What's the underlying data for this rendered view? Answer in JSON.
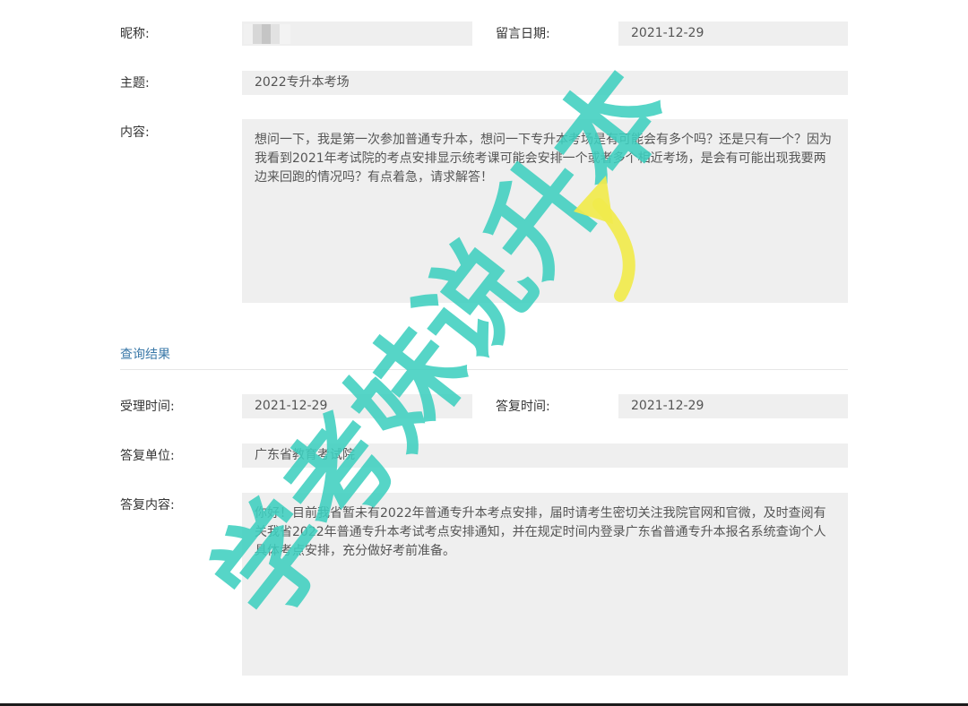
{
  "form": {
    "nickname_label": "昵称:",
    "nickname_value": "",
    "date_label": "留言日期:",
    "date_value": "2021-12-29",
    "subject_label": "主题:",
    "subject_value": "2022专升本考场",
    "content_label": "内容:",
    "content_value": "想问一下，我是第一次参加普通专升本，想问一下专升本考场是有可能会有多个吗？还是只有一个？因为我看到2021年考试院的考点安排显示统考课可能会安排一个或者多个相近考场，是会有可能出现我要两边来回跑的情况吗？有点着急，请求解答！"
  },
  "result": {
    "section_title": "查询结果",
    "accept_time_label": "受理时间:",
    "accept_time_value": "2021-12-29",
    "reply_time_label": "答复时间:",
    "reply_time_value": "2021-12-29",
    "reply_unit_label": "答复单位:",
    "reply_unit_value": "广东省教育考试院",
    "reply_content_label": "答复内容:",
    "reply_content_value": "你好！目前我省暂未有2022年普通专升本考点安排，届时请考生密切关注我院官网和官微，及时查阅有关我省2022年普通专升本考试考点安排通知，并在规定时间内登录广东省普通专升本报名系统查询个人具体考点安排，充分做好考前准备。"
  },
  "watermark": {
    "text": "学考妹说升本",
    "color": "#3fcfbf",
    "arrow_color": "#f1ea4c"
  }
}
